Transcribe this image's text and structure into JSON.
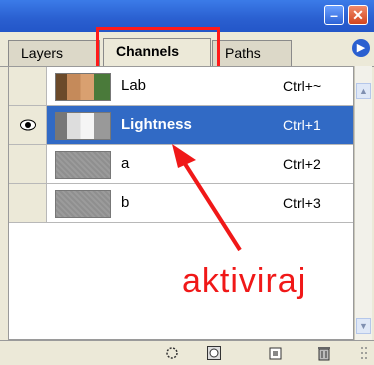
{
  "window": {
    "minimize_label": "–",
    "close_label": "✕"
  },
  "tabs": [
    {
      "label": "Layers"
    },
    {
      "label": "Channels"
    },
    {
      "label": "Paths"
    }
  ],
  "panel_menu_icon": "right-arrow-circle-icon",
  "channels": [
    {
      "name": "Lab",
      "shortcut": "Ctrl+~",
      "visible": false,
      "selected": false
    },
    {
      "name": "Lightness",
      "shortcut": "Ctrl+1",
      "visible": true,
      "selected": true
    },
    {
      "name": "a",
      "shortcut": "Ctrl+2",
      "visible": false,
      "selected": false
    },
    {
      "name": "b",
      "shortcut": "Ctrl+3",
      "visible": false,
      "selected": false
    }
  ],
  "annotation": {
    "text": "aktiviraj",
    "color": "#f01818"
  },
  "bottom_icons": [
    "load-selection-icon",
    "save-selection-icon",
    "new-channel-icon",
    "delete-channel-icon"
  ],
  "colors": {
    "selection": "#316ac5",
    "highlight_box": "#ff1a1a",
    "titlebar": "#2a5fd0"
  }
}
